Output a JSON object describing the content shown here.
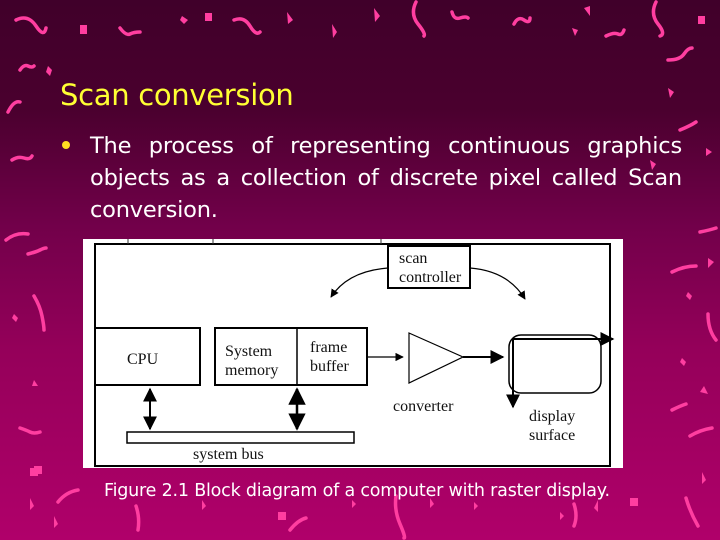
{
  "slide": {
    "title": "Scan conversion",
    "bullets": [
      "The process of representing continuous graphics objects as a collection of discrete pixel called Scan conversion."
    ],
    "caption": "Figure 2.1 Block diagram of a computer with raster display.",
    "colors": {
      "title": "#ffff33",
      "text": "#ffffff",
      "bullet": "#ffdd22",
      "background_top": "#40002a",
      "background_bottom": "#b0006a",
      "confetti": "#ff3ea0"
    }
  },
  "diagram": {
    "blocks": {
      "cpu": "CPU",
      "system_memory_line1": "System",
      "system_memory_line2": "memory",
      "frame_buffer_line1": "frame",
      "frame_buffer_line2": "buffer",
      "scan_controller_line1": "scan",
      "scan_controller_line2": "controller",
      "converter": "converter",
      "display_surface_line1": "display",
      "display_surface_line2": "surface",
      "system_bus": "system bus"
    }
  }
}
